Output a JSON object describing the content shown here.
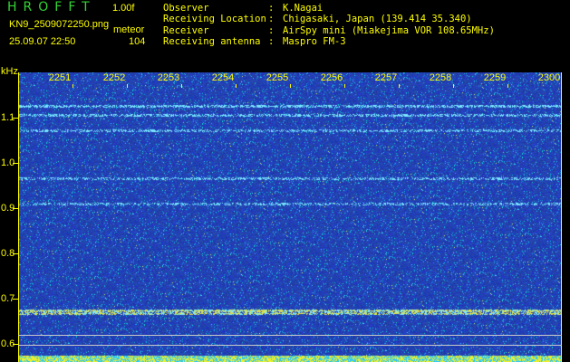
{
  "header": {
    "app_title": "HROFFT",
    "version": "1.00f",
    "filename": "KN9_2509072250.png",
    "mode": "meteor",
    "datetime": "25.09.07 22:50",
    "count": "104"
  },
  "station": [
    {
      "label": "Observer",
      "value": "K.Nagai"
    },
    {
      "label": "Receiving Location",
      "value": "Chigasaki, Japan (139.414 35.340)"
    },
    {
      "label": "Receiver",
      "value": "AirSpy mini (Miakejima VOR 108.65MHz)"
    },
    {
      "label": "Receiving antenna",
      "value": "Maspro FM-3"
    }
  ],
  "axes": {
    "y_unit": "kHz",
    "x_ticks": [
      "2251",
      "2252",
      "2253",
      "2254",
      "2255",
      "2256",
      "2257",
      "2258",
      "2259",
      "2300"
    ],
    "y_ticks": [
      "1.1",
      "1.0",
      "0.9",
      "0.8",
      "0.7",
      "0.6"
    ]
  },
  "colors": {
    "text": "#ffff00",
    "title": "#35d235",
    "plot_bg": "#1f33a8"
  }
}
